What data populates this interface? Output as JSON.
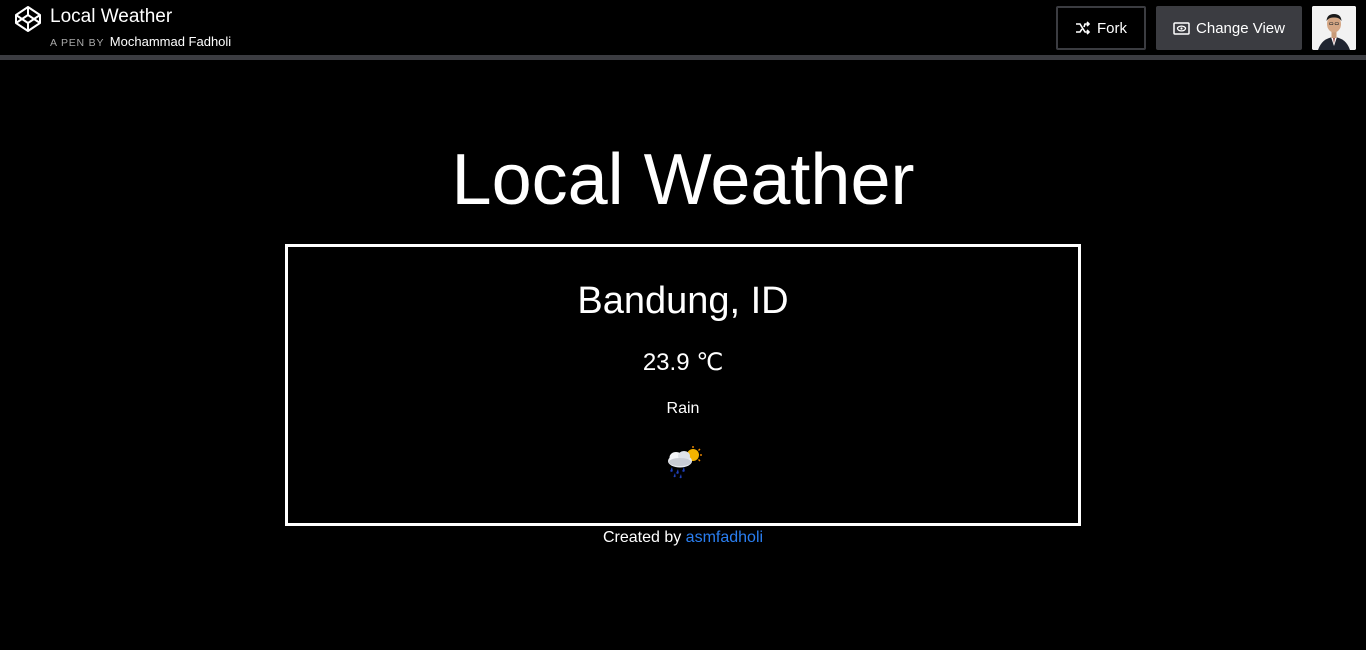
{
  "header": {
    "title": "Local Weather",
    "pen_by_label": "A PEN BY",
    "author": "Mochammad Fadholi",
    "fork_label": "Fork",
    "change_view_label": "Change View"
  },
  "page": {
    "title": "Local Weather"
  },
  "weather": {
    "location": "Bandung, ID",
    "temperature": "23.9 ℃",
    "condition": "Rain",
    "icon": "rain-sun-cloud-icon"
  },
  "footer": {
    "created_by_label": "Created by",
    "author_link": "asmfadholi"
  },
  "colors": {
    "background": "#000000",
    "header_divider": "#3b3c41",
    "link": "#2a7ef0"
  }
}
